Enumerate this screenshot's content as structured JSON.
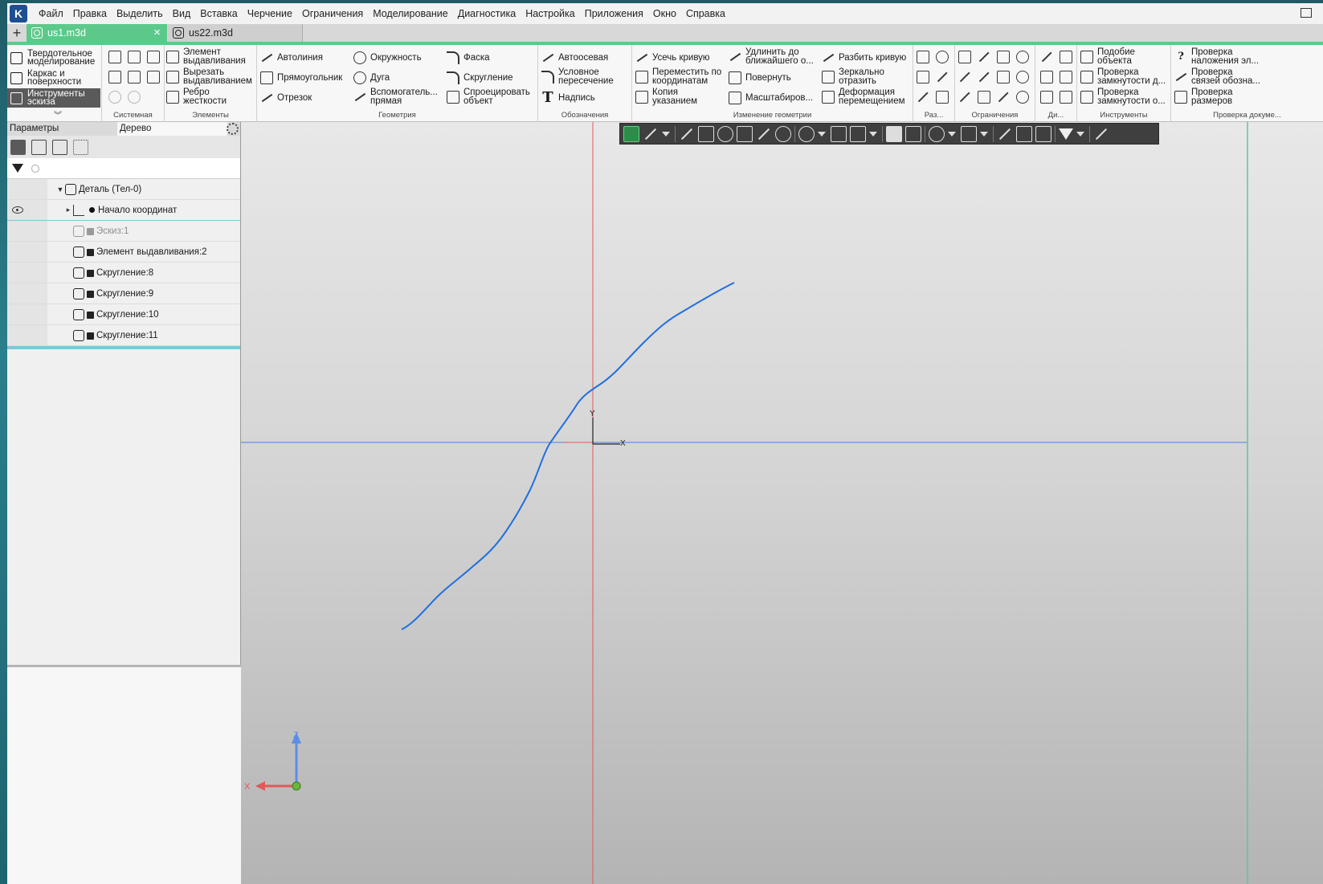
{
  "menu": [
    "Файл",
    "Правка",
    "Выделить",
    "Вид",
    "Вставка",
    "Черчение",
    "Ограничения",
    "Моделирование",
    "Диагностика",
    "Настройка",
    "Приложения",
    "Окно",
    "Справка"
  ],
  "tabs": {
    "active": "us1.m3d",
    "inactive": "us22.m3d"
  },
  "ribbon": {
    "modes": [
      "Твердотельное\nмоделирование",
      "Каркас и\nповерхности",
      "Инструменты\nэскиза"
    ],
    "groups": {
      "system": "Системная",
      "elements": "Элементы",
      "geometry": "Геометрия",
      "designations": "Обозначения",
      "geometry_change": "Изменение геометрии",
      "dimensions": "Раз...",
      "constraints": "Ограничения",
      "diagnostics": "Ди...",
      "tools": "Инструменты",
      "doc_check": "Проверка докуме..."
    },
    "elements": [
      "Элемент\nвыдавливания",
      "Вырезать\nвыдавливанием",
      "Ребро\nжесткости"
    ],
    "geometry_col1": [
      "Автолиния",
      "Прямоугольник",
      "Отрезок"
    ],
    "geometry_col2": [
      "Окружность",
      "Дуга",
      "Вспомогатель...\nпрямая"
    ],
    "geometry_col3": [
      "Фаска",
      "Скругление",
      "Спроецировать\nобъект"
    ],
    "designations": [
      "Автоосевая",
      "Условное\nпересечение",
      "Надпись"
    ],
    "change_col1": [
      "Усечь кривую",
      "Переместить по\nкоординатам",
      "Копия\nуказанием"
    ],
    "change_col2": [
      "Удлинить до\nближайшего о...",
      "Повернуть",
      "Масштабиров..."
    ],
    "change_col3": [
      "Разбить кривую",
      "Зеркально\nотразить",
      "Деформация\nперемещением"
    ],
    "tools": [
      "Подобие\nобъекта",
      "Проверка\nзамкнутости д...",
      "Проверка\nзамкнутости о..."
    ],
    "doc_check": [
      "Проверка\nналожения эл...",
      "Проверка\nсвязей обозна...",
      "Проверка\nразмеров"
    ]
  },
  "panel": {
    "tabs": [
      "Параметры",
      "Дерево"
    ],
    "search_placeholder": "",
    "tree": [
      {
        "label": "Деталь (Тел-0)"
      },
      {
        "label": "Начало координат"
      },
      {
        "label": "Эскиз:1"
      },
      {
        "label": "Элемент выдавливания:2"
      },
      {
        "label": "Скругление:8"
      },
      {
        "label": "Скругление:9"
      },
      {
        "label": "Скругление:10"
      },
      {
        "label": "Скругление:11"
      }
    ]
  },
  "viewport": {
    "axis_labels": {
      "x": "X",
      "y": "Y",
      "z": "Z"
    },
    "colors": {
      "sketch_curve": "#1f6fe0",
      "x_axis_line": "#4a7fe8",
      "y_axis_line": "#e05a5a",
      "accent_green": "#5cc98a"
    }
  }
}
